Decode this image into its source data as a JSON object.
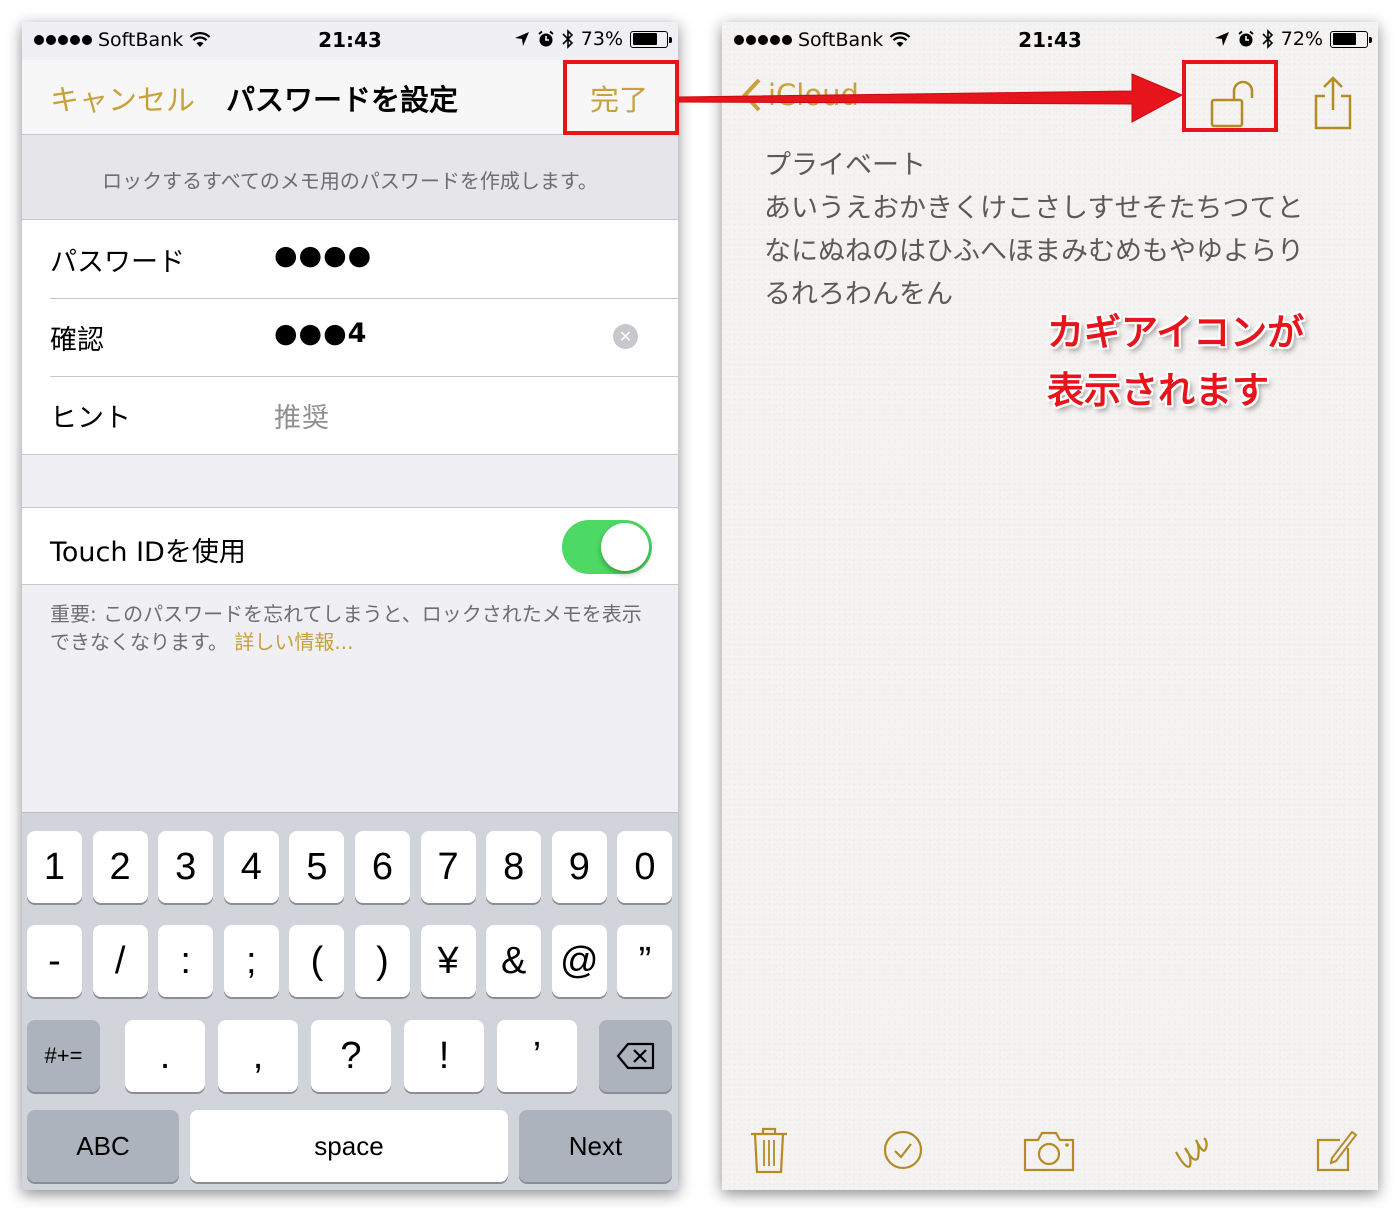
{
  "colors": {
    "accent": "#c7a13c",
    "toggle_on": "#4cd964",
    "annotation_red": "#e8141b"
  },
  "left_screen": {
    "status_bar": {
      "carrier": "SoftBank",
      "signal_bars": 5,
      "time": "21:43",
      "battery_percent": "73%",
      "battery_level": 0.73,
      "icons": [
        "location-icon",
        "alarm-icon",
        "bluetooth-icon",
        "battery-icon"
      ]
    },
    "nav": {
      "cancel_label": "キャンセル",
      "title": "パスワードを設定",
      "done_label": "完了"
    },
    "section_header": "ロックするすべてのメモ用のパスワードを作成します。",
    "form": [
      {
        "label": "パスワード",
        "value": "●●●●",
        "is_placeholder": false
      },
      {
        "label": "確認",
        "value": "●●●4",
        "is_placeholder": false,
        "clear_button": true
      },
      {
        "label": "ヒント",
        "value": "推奨",
        "is_placeholder": true
      }
    ],
    "touch_id": {
      "label": "Touch IDを使用",
      "enabled": true
    },
    "footer": {
      "text": "重要: このパスワードを忘れてしまうと、ロックされたメモを表示できなくなります。",
      "link": "詳しい情報..."
    },
    "keyboard": {
      "row1": [
        "1",
        "2",
        "3",
        "4",
        "5",
        "6",
        "7",
        "8",
        "9",
        "0"
      ],
      "row2": [
        "-",
        "/",
        ":",
        ";",
        "(",
        ")",
        "¥",
        "&",
        "@",
        "”"
      ],
      "row3_left": "#+=",
      "row3": [
        ".",
        ",",
        "?",
        "!",
        "’"
      ],
      "row3_right_icon": "backspace-icon",
      "abc_label": "ABC",
      "space_label": "space",
      "next_label": "Next"
    }
  },
  "right_screen": {
    "status_bar": {
      "carrier": "SoftBank",
      "signal_bars": 5,
      "time": "21:43",
      "battery_percent": "72%",
      "battery_level": 0.72,
      "icons": [
        "location-icon",
        "alarm-icon",
        "bluetooth-icon",
        "battery-icon"
      ]
    },
    "nav": {
      "back_label": "iCloud",
      "lock_icon": "unlocked-lock-icon",
      "share_icon": "share-icon"
    },
    "note_lines": [
      "プライベート",
      "あいうえおかきくけこさしすせそたちつてと",
      "なにぬねのはひふへほまみむめもやゆよらり",
      "るれろわんをん"
    ],
    "toolbar": [
      "trash-icon",
      "checklist-icon",
      "camera-icon",
      "sketch-icon",
      "compose-icon"
    ]
  },
  "annotation": {
    "line1": "カギアイコンが",
    "line2": "表示されます"
  }
}
